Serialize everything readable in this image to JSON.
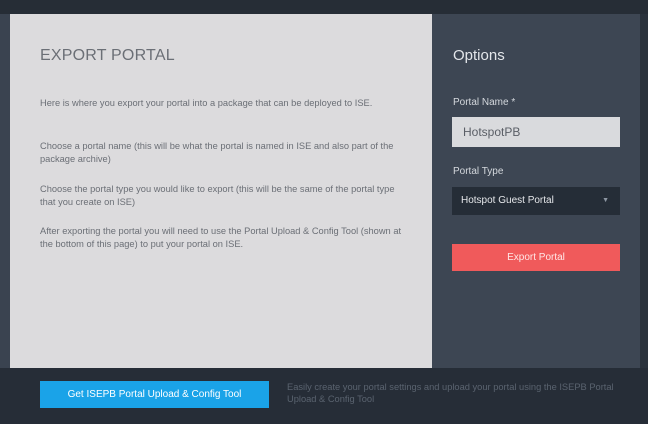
{
  "left": {
    "title": "EXPORT PORTAL",
    "paragraphs": [
      "Here is where you export your portal into a package that can be deployed to ISE.",
      "Choose a portal name (this will be what the portal is named in ISE and also part of the package archive)",
      "Choose the portal type you would like to export (this will be the same of the portal type that you create on ISE)",
      "After exporting the portal you will need to use the Portal Upload & Config Tool (shown at the bottom of this page) to put your portal on ISE."
    ]
  },
  "options": {
    "title": "Options",
    "portal_name_label": "Portal Name *",
    "portal_name_value": "HotspotPB",
    "portal_type_label": "Portal Type",
    "portal_type_value": "Hotspot Guest Portal",
    "chevron_icon": "chevron-down",
    "export_button": "Export Portal"
  },
  "footer": {
    "tool_button": "Get ISEPB Portal Upload & Config Tool",
    "text": "Easily create your portal settings and upload your portal using the ISEPB Portal Upload & Config Tool"
  },
  "colors": {
    "accent_red": "#f05a5b",
    "accent_blue": "#1aa3e8",
    "panel_light": "#dcdbdd",
    "panel_dark": "#3d4653"
  }
}
